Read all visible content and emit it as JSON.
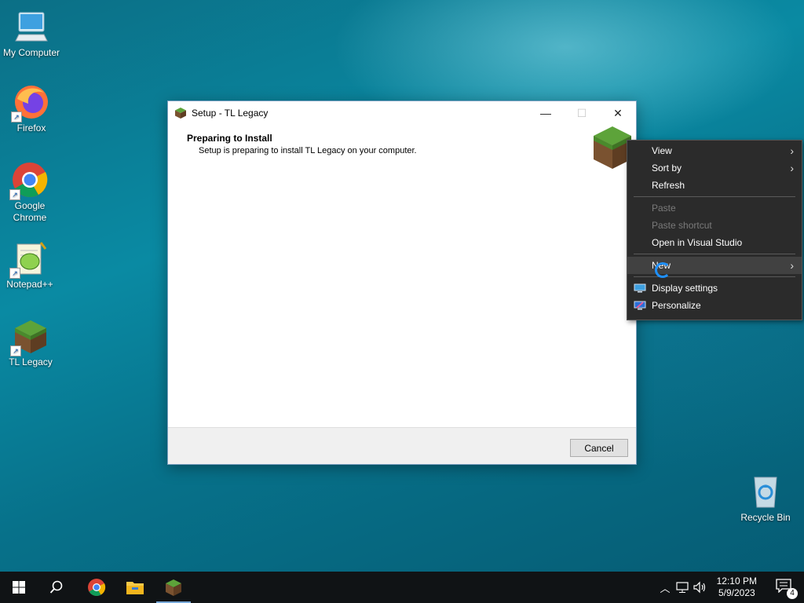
{
  "desktop": {
    "icons": [
      {
        "label": "My Computer",
        "icon": "computer-icon"
      },
      {
        "label": "Firefox",
        "icon": "firefox-icon"
      },
      {
        "label": "Google Chrome",
        "icon": "chrome-icon"
      },
      {
        "label": "Notepad++",
        "icon": "notepadpp-icon"
      },
      {
        "label": "TL Legacy",
        "icon": "grass-block-icon"
      },
      {
        "label": "Recycle Bin",
        "icon": "recycle-bin-icon"
      }
    ]
  },
  "setup_window": {
    "title": "Setup - TL Legacy",
    "heading": "Preparing to Install",
    "subtext": "Setup is preparing to install TL Legacy on your computer.",
    "cancel_label": "Cancel"
  },
  "context_menu": {
    "items": [
      {
        "label": "View",
        "submenu": true,
        "enabled": true
      },
      {
        "label": "Sort by",
        "submenu": true,
        "enabled": true
      },
      {
        "label": "Refresh",
        "submenu": false,
        "enabled": true
      },
      {
        "label": "Paste",
        "submenu": false,
        "enabled": false
      },
      {
        "label": "Paste shortcut",
        "submenu": false,
        "enabled": false
      },
      {
        "label": "Open in Visual Studio",
        "submenu": false,
        "enabled": true
      },
      {
        "label": "New",
        "submenu": true,
        "enabled": true
      },
      {
        "label": "Display settings",
        "submenu": false,
        "enabled": true,
        "icon": "display-icon"
      },
      {
        "label": "Personalize",
        "submenu": false,
        "enabled": true,
        "icon": "personalize-icon"
      }
    ]
  },
  "taskbar": {
    "clock_time": "12:10 PM",
    "clock_date": "5/9/2023",
    "notification_count": "4"
  }
}
